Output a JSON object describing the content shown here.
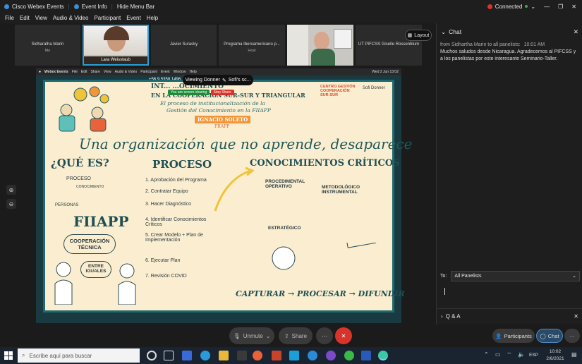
{
  "titlebar": {
    "app": "Cisco Webex Events",
    "event_info": "Event Info",
    "hide_menu": "Hide Menu Bar",
    "status": "Connected",
    "caret": "⌄"
  },
  "menubar": [
    "File",
    "Edit",
    "View",
    "Audio & Video",
    "Participant",
    "Event",
    "Help"
  ],
  "participants": [
    {
      "name": "Sidharatha Marin",
      "sub": "Me"
    },
    {
      "name": "Lara Weisstaub",
      "sub": ""
    },
    {
      "name": "Javier Surasky",
      "sub": ""
    },
    {
      "name": "Programa Iberoamericano p...",
      "sub": "Host"
    },
    {
      "name": "",
      "sub": ""
    },
    {
      "name": "UT PIFCSS Giselle Rossenblum",
      "sub": ""
    }
  ],
  "layout_label": "Layout",
  "viewing_label": "Viewing Donner",
  "viewing_suffix": "Sofi's sc...",
  "share_bar": {
    "label": "You are screen sharing",
    "stop": "Stop Share"
  },
  "mac_menu": [
    "Webex Events",
    "File",
    "Edit",
    "Share",
    "View",
    "Audio & Video",
    "Participant",
    "Event",
    "Window",
    "Help"
  ],
  "mac_right": "Wed 2 Jun 13:02",
  "mac_phone": "+56 9 5358 1496",
  "poster": {
    "header1": "INT... ...OCIMIENTO",
    "header2": "EN LA COOPERACIÓN SUR-SUR Y TRIANGULAR",
    "header3": "El proceso de institucionalización de la",
    "header4": "Gestión del Conocimiento en la FIIAPP",
    "speaker": "IGNACIO SOLETO",
    "speaker_org": "FIIAPP",
    "logo1": "CENTRO GESTIÓN COOPERACIÓN SUR-SUR",
    "logo2": "Sofi Donner",
    "headline": "Una organización que no aprende, desaparece",
    "que_es": "¿QUÉ ES?",
    "proceso_small": "PROCESO",
    "conocimiento": "CONOCIMIENTO",
    "personas": "PERSONAS",
    "fiiapp": "FIIAPP",
    "cooperacion": "COOPERACIÓN TÉCNICA",
    "entre": "ENTRE IGUALES",
    "proceso_title": "PROCESO",
    "steps": [
      "1. Aprobación del Programa",
      "2. Contratar Equipo",
      "3. Hacer Diagnóstico",
      "4. Identificar Conocimientos Críticos",
      "5. Crear Modelo + Plan de Implementación",
      "6. Ejecutar Plan",
      "7. Revisión COVID"
    ],
    "conocimientos_title": "CONOCIMIENTOS CRÍTICOS",
    "procedimental": "PROCEDIMENTAL OPERATIVO",
    "metodologico": "METODOLÓGICO INSTRUMENTAL",
    "estrategico": "ESTRATÉGICO",
    "bottom": "CAPTURAR → PROCESAR → DIFUNDIR"
  },
  "controls": {
    "unmute": "Unmute",
    "share": "Share",
    "more": "···",
    "leave": "✕"
  },
  "chat": {
    "title": "Chat",
    "meta": "from Sidhartha Marin to all panelists:",
    "time": "10:01 AM",
    "message": "Muchos saludos desde Nicaragua. Agradecemos al PIFCSS y a los panelistas por este interesante Seminario-Taller.",
    "to_label": "To:",
    "to_value": "All Panelists"
  },
  "qa_label": "Q & A",
  "right_buttons": {
    "participants": "Participants",
    "chat": "Chat",
    "more": "···"
  },
  "taskbar": {
    "search_placeholder": "Escribe aquí para buscar",
    "lang": "ESP",
    "time": "10:02",
    "date": "2/6/2021"
  }
}
